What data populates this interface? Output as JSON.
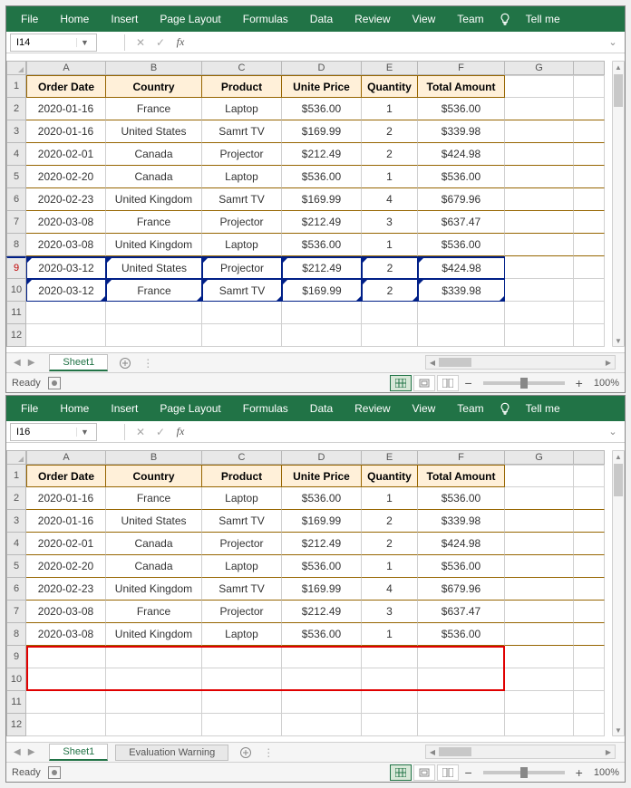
{
  "ribbon": {
    "tabs": [
      "File",
      "Home",
      "Insert",
      "Page Layout",
      "Formulas",
      "Data",
      "Review",
      "View",
      "Team"
    ],
    "tellme": "Tell me"
  },
  "namebox": {
    "top": "I14",
    "bottom": "I16"
  },
  "columns": [
    "A",
    "B",
    "C",
    "D",
    "E",
    "F",
    "G"
  ],
  "headers": [
    "Order Date",
    "Country",
    "Product",
    "Unite Price",
    "Quantity",
    "Total Amount"
  ],
  "rows": [
    {
      "n": "1",
      "a": "",
      "b": "",
      "c": "",
      "d": "",
      "e": "",
      "f": ""
    },
    {
      "n": "2",
      "a": "2020-01-16",
      "b": "France",
      "c": "Laptop",
      "d": "$536.00",
      "e": "1",
      "f": "$536.00"
    },
    {
      "n": "3",
      "a": "2020-01-16",
      "b": "United States",
      "c": "Samrt TV",
      "d": "$169.99",
      "e": "2",
      "f": "$339.98"
    },
    {
      "n": "4",
      "a": "2020-02-01",
      "b": "Canada",
      "c": "Projector",
      "d": "$212.49",
      "e": "2",
      "f": "$424.98"
    },
    {
      "n": "5",
      "a": "2020-02-20",
      "b": "Canada",
      "c": "Laptop",
      "d": "$536.00",
      "e": "1",
      "f": "$536.00"
    },
    {
      "n": "6",
      "a": "2020-02-23",
      "b": "United Kingdom",
      "c": "Samrt TV",
      "d": "$169.99",
      "e": "4",
      "f": "$679.96"
    },
    {
      "n": "7",
      "a": "2020-03-08",
      "b": "France",
      "c": "Projector",
      "d": "$212.49",
      "e": "3",
      "f": "$637.47"
    },
    {
      "n": "8",
      "a": "2020-03-08",
      "b": "United Kingdom",
      "c": "Laptop",
      "d": "$536.00",
      "e": "1",
      "f": "$536.00"
    }
  ],
  "insert_rows_top": [
    {
      "n": "9",
      "a": "2020-03-12",
      "b": "United States",
      "c": "Projector",
      "d": "$212.49",
      "e": "2",
      "f": "$424.98"
    },
    {
      "n": "10",
      "a": "2020-03-12",
      "b": "France",
      "c": "Samrt TV",
      "d": "$169.99",
      "e": "2",
      "f": "$339.98"
    }
  ],
  "blank_rows": [
    {
      "n": "9"
    },
    {
      "n": "10"
    },
    {
      "n": "11"
    },
    {
      "n": "12"
    }
  ],
  "tabs_top": [
    "Sheet1"
  ],
  "tabs_bottom": [
    "Sheet1",
    "Evaluation Warning"
  ],
  "status": {
    "ready": "Ready",
    "zoom": "100%"
  }
}
